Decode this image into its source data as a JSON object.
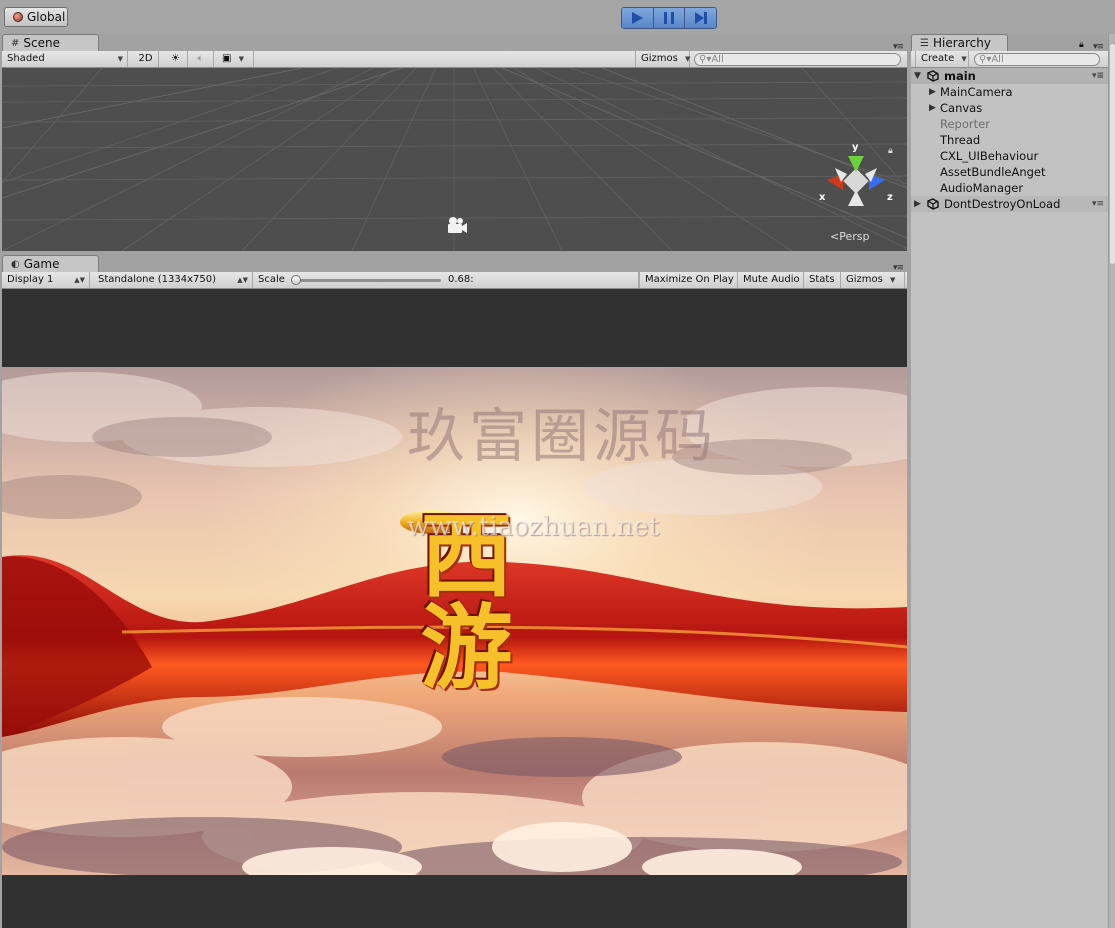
{
  "toolbar": {
    "global_label": "Global",
    "play_controls": [
      {
        "name": "play",
        "icon": "play-icon"
      },
      {
        "name": "pause",
        "icon": "pause-icon"
      },
      {
        "name": "step",
        "icon": "step-icon"
      }
    ],
    "accent": "#5a86c8"
  },
  "scene": {
    "tab_label": "Scene",
    "shading_mode": "Shaded",
    "mode_2d": "2D",
    "gizmos_label": "Gizmos",
    "search_placeholder": "All",
    "persp_label": "Persp",
    "axes": {
      "x": "x",
      "y": "y",
      "z": "z"
    },
    "axis_colors": {
      "x": "#d23a1e",
      "y": "#6cd43a",
      "z": "#3a6cf0"
    }
  },
  "game": {
    "tab_label": "Game",
    "display": "Display 1",
    "resolution": "Standalone (1334x750)",
    "scale_label": "Scale",
    "scale_value": "0.68:",
    "maximize_on_play": "Maximize On Play",
    "mute_audio": "Mute Audio",
    "stats": "Stats",
    "gizmos_label": "Gizmos",
    "title_art": "西游",
    "watermark_cn": "玖富圈源码",
    "watermark_url": "www.tiaozhuan.net"
  },
  "hierarchy": {
    "tab_label": "Hierarchy",
    "create_label": "Create",
    "search_placeholder": "All",
    "scenes": [
      {
        "name": "main",
        "expanded": true,
        "children": [
          {
            "name": "MainCamera",
            "has_children": true,
            "active": true
          },
          {
            "name": "Canvas",
            "has_children": true,
            "active": true
          },
          {
            "name": "Reporter",
            "has_children": false,
            "active": false
          },
          {
            "name": "Thread",
            "has_children": false,
            "active": true
          },
          {
            "name": "CXL_UIBehaviour",
            "has_children": false,
            "active": true
          },
          {
            "name": "AssetBundleAnget",
            "has_children": false,
            "active": true
          },
          {
            "name": "AudioManager",
            "has_children": false,
            "active": true
          }
        ]
      },
      {
        "name": "DontDestroyOnLoad",
        "expanded": false,
        "children": []
      }
    ]
  }
}
